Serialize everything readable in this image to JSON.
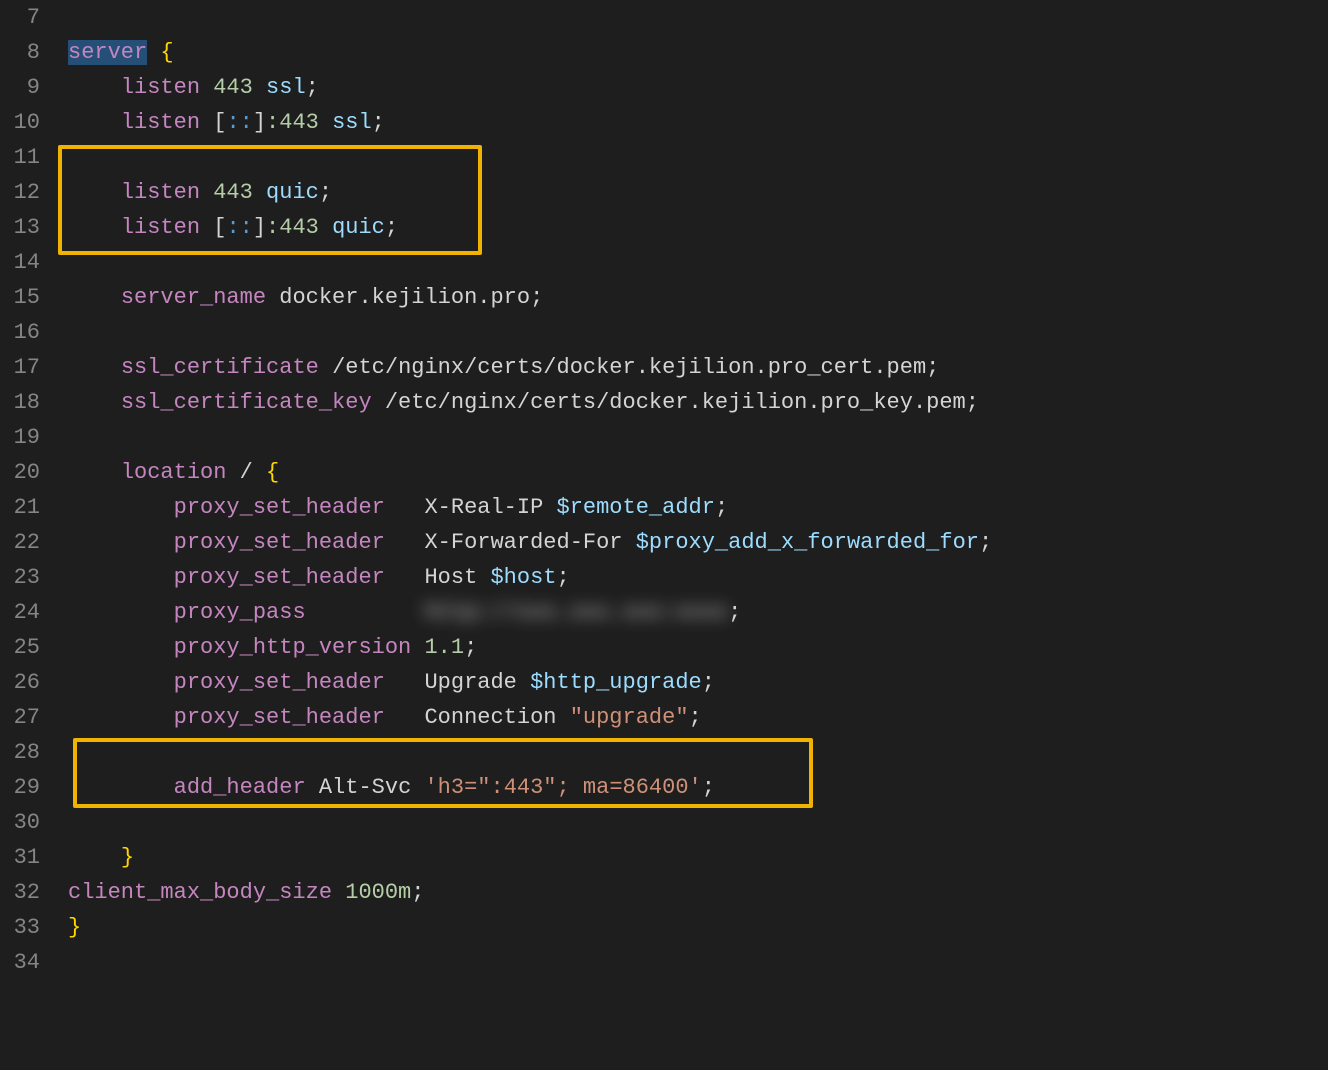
{
  "lines": {
    "start": 7,
    "end": 34
  },
  "code": {
    "l8": {
      "server": "server",
      "brace": "{"
    },
    "l9": {
      "listen": "listen",
      "port": "443",
      "ssl": "ssl"
    },
    "l10": {
      "listen": "listen",
      "bracket_open": "[",
      "colons": "::",
      "bracket_close": "]",
      "port": ":443",
      "ssl": "ssl"
    },
    "l12": {
      "listen": "listen",
      "port": "443",
      "quic": "quic"
    },
    "l13": {
      "listen": "listen",
      "bracket_open": "[",
      "colons": "::",
      "bracket_close": "]",
      "port": ":443",
      "quic": "quic"
    },
    "l15": {
      "server_name": "server_name",
      "domain": "docker.kejilion.pro"
    },
    "l17": {
      "ssl_certificate": "ssl_certificate",
      "path": "/etc/nginx/certs/docker.kejilion.pro_cert.pem"
    },
    "l18": {
      "ssl_certificate_key": "ssl_certificate_key",
      "path": "/etc/nginx/certs/docker.kejilion.pro_key.pem"
    },
    "l20": {
      "location": "location",
      "slash": "/",
      "brace": "{"
    },
    "l21": {
      "proxy_set_header": "proxy_set_header",
      "header": "X-Real-IP",
      "var": "$remote_addr"
    },
    "l22": {
      "proxy_set_header": "proxy_set_header",
      "header": "X-Forwarded-For",
      "var": "$proxy_add_x_forwarded_for"
    },
    "l23": {
      "proxy_set_header": "proxy_set_header",
      "header": "Host",
      "var": "$host"
    },
    "l24": {
      "proxy_pass": "proxy_pass",
      "blurred": "http://xxx.xxx.xxx:xxxx"
    },
    "l25": {
      "proxy_http_version": "proxy_http_version",
      "val": "1.1"
    },
    "l26": {
      "proxy_set_header": "proxy_set_header",
      "header": "Upgrade",
      "var": "$http_upgrade"
    },
    "l27": {
      "proxy_set_header": "proxy_set_header",
      "header": "Connection",
      "str": "\"upgrade\""
    },
    "l29": {
      "add_header": "add_header",
      "header": "Alt-Svc",
      "str": "'h3=\":443\"; ma=86400'"
    },
    "l31": {
      "brace": "}"
    },
    "l32": {
      "client_max_body_size": "client_max_body_size",
      "val": "1000m"
    },
    "l33": {
      "brace": "}"
    }
  }
}
